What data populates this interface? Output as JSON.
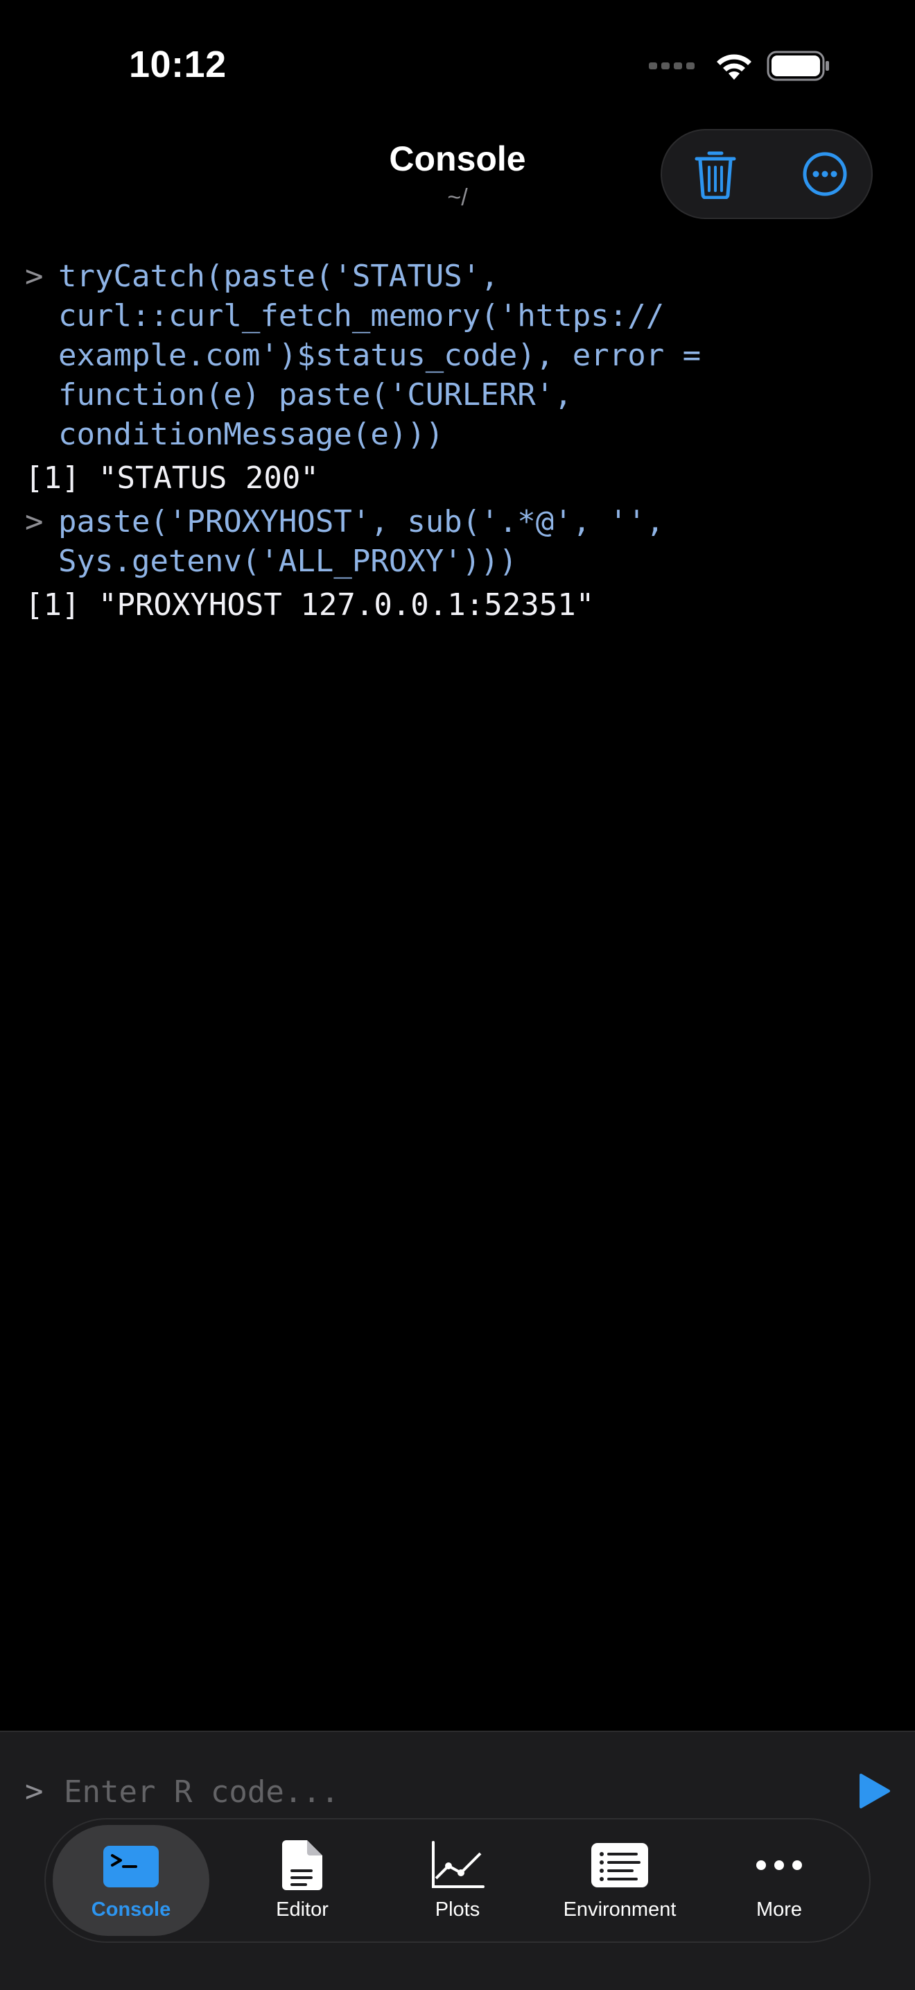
{
  "status_bar": {
    "time": "10:12"
  },
  "nav": {
    "title": "Console",
    "subtitle": "~/"
  },
  "console": {
    "entries": [
      {
        "prompt": ">",
        "command": "tryCatch(paste('STATUS',\ncurl::curl_fetch_memory('https://\nexample.com')$status_code), error =\nfunction(e) paste('CURLERR',\nconditionMessage(e)))",
        "output": "[1] \"STATUS 200\""
      },
      {
        "prompt": ">",
        "command": "paste('PROXYHOST', sub('.*@', '',\nSys.getenv('ALL_PROXY')))",
        "output": "[1] \"PROXYHOST 127.0.0.1:52351\""
      }
    ]
  },
  "input": {
    "prompt": ">",
    "placeholder": "Enter R code...",
    "value": ""
  },
  "tabs": [
    {
      "label": "Console",
      "icon": "terminal-icon",
      "active": true
    },
    {
      "label": "Editor",
      "icon": "document-icon",
      "active": false
    },
    {
      "label": "Plots",
      "icon": "line-chart-icon",
      "active": false
    },
    {
      "label": "Environment",
      "icon": "list-icon",
      "active": false
    },
    {
      "label": "More",
      "icon": "ellipsis-icon",
      "active": false
    }
  ],
  "colors": {
    "accent": "#2d95f0",
    "command_text": "#8fb4e6",
    "background": "#000000"
  }
}
